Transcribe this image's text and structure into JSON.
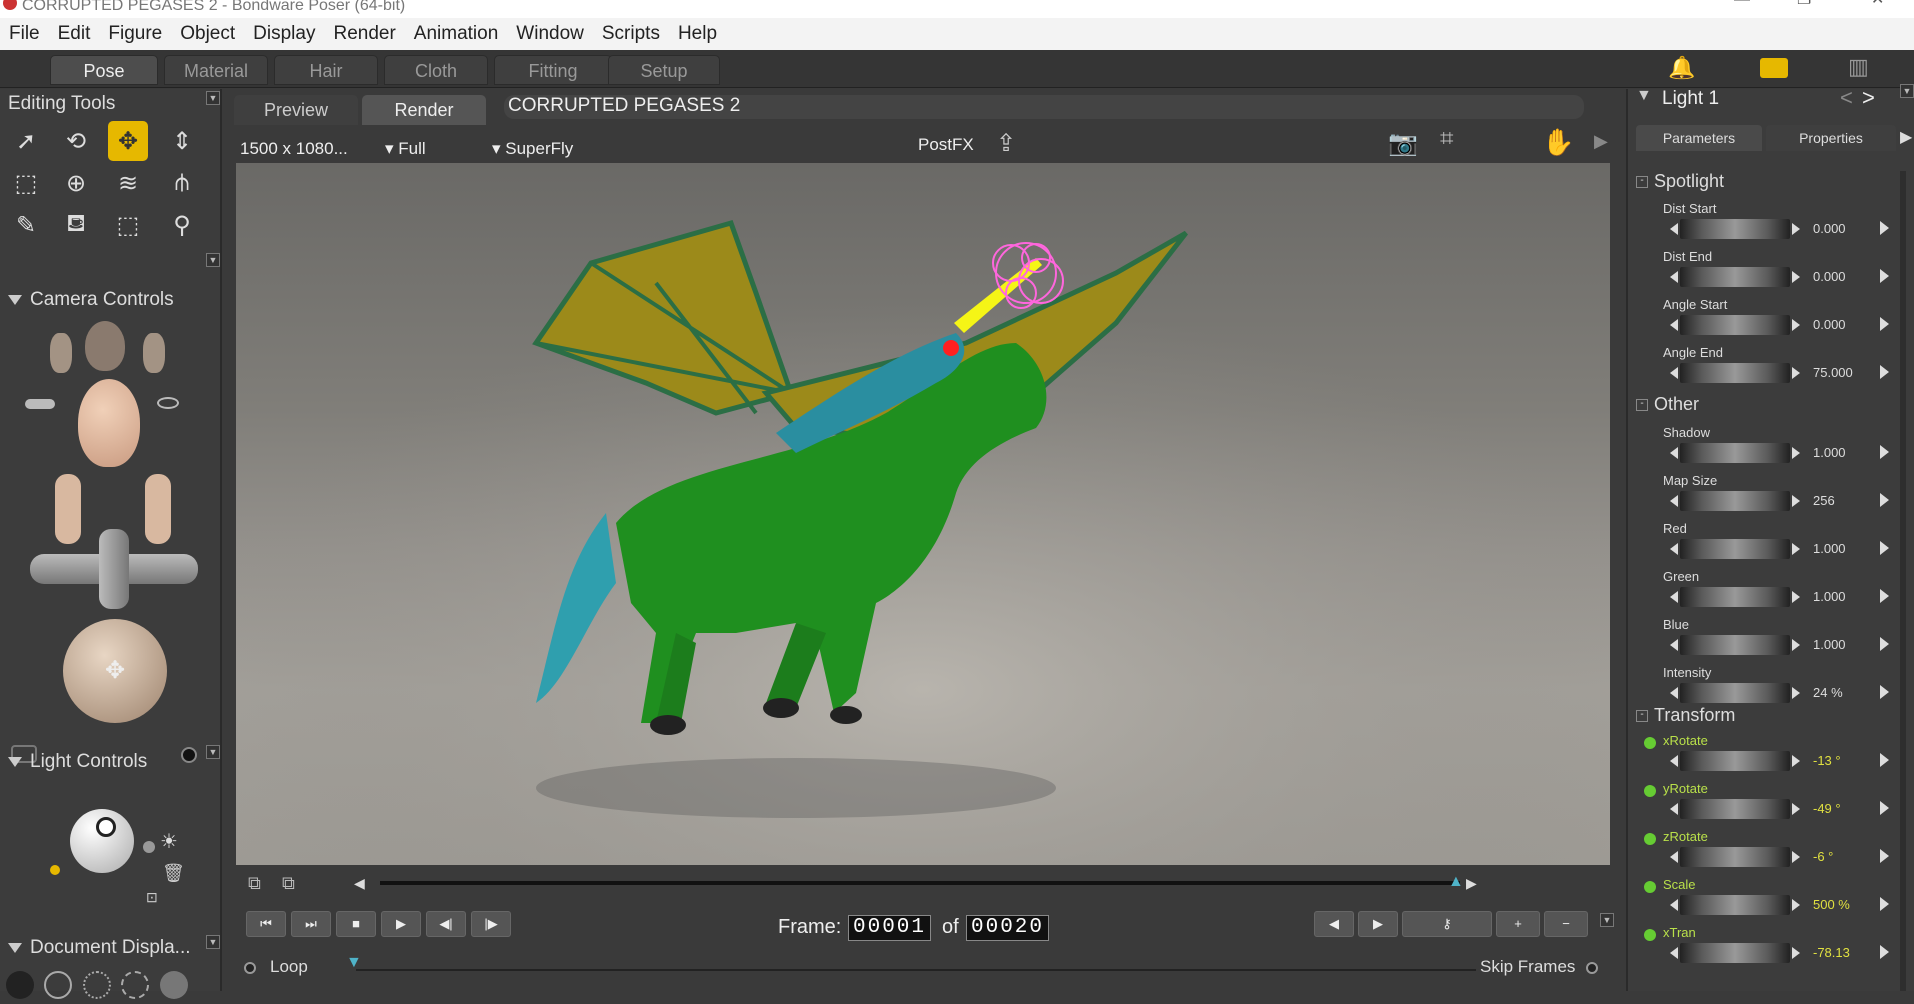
{
  "window": {
    "title": "CORRUPTED PEGASES 2 - Bondware Poser (64-bit)"
  },
  "menu": [
    "File",
    "Edit",
    "Figure",
    "Object",
    "Display",
    "Render",
    "Animation",
    "Window",
    "Scripts",
    "Help"
  ],
  "rooms": [
    "Pose",
    "Material",
    "Hair",
    "Cloth",
    "Fitting",
    "Setup"
  ],
  "active_room": "Pose",
  "left": {
    "editing_tools": "Editing Tools",
    "camera_controls": "Camera Controls",
    "light_controls": "Light Controls",
    "document_display": "Document Displa..."
  },
  "viewport": {
    "tabs": [
      "Preview",
      "Render"
    ],
    "doc_title": "CORRUPTED PEGASES 2",
    "resolution": "1500 x 1080...",
    "quality": "Full",
    "engine": "SuperFly",
    "postfx": "PostFX"
  },
  "right": {
    "title": "Light 1",
    "tabs": [
      "Parameters",
      "Properties"
    ],
    "groups": {
      "spotlight": "Spotlight",
      "other": "Other",
      "transform": "Transform"
    },
    "spotlight_params": [
      {
        "label": "Dist Start",
        "value": "0.000"
      },
      {
        "label": "Dist End",
        "value": "0.000"
      },
      {
        "label": "Angle Start",
        "value": "0.000"
      },
      {
        "label": "Angle End",
        "value": "75.000"
      }
    ],
    "other_params": [
      {
        "label": "Shadow",
        "value": "1.000"
      },
      {
        "label": "Map Size",
        "value": "256"
      },
      {
        "label": "Red",
        "value": "1.000"
      },
      {
        "label": "Green",
        "value": "1.000"
      },
      {
        "label": "Blue",
        "value": "1.000"
      },
      {
        "label": "Intensity",
        "value": "24 %"
      }
    ],
    "transform_params": [
      {
        "label": "xRotate",
        "value": "-13 °"
      },
      {
        "label": "yRotate",
        "value": "-49 °"
      },
      {
        "label": "zRotate",
        "value": "-6 °"
      },
      {
        "label": "Scale",
        "value": "500 %"
      },
      {
        "label": "xTran",
        "value": "-78.13"
      }
    ]
  },
  "timeline": {
    "frame_label": "Frame:",
    "frame": "00001",
    "of_label": "of",
    "total": "00020",
    "loop": "Loop",
    "skip_frames": "Skip Frames"
  }
}
